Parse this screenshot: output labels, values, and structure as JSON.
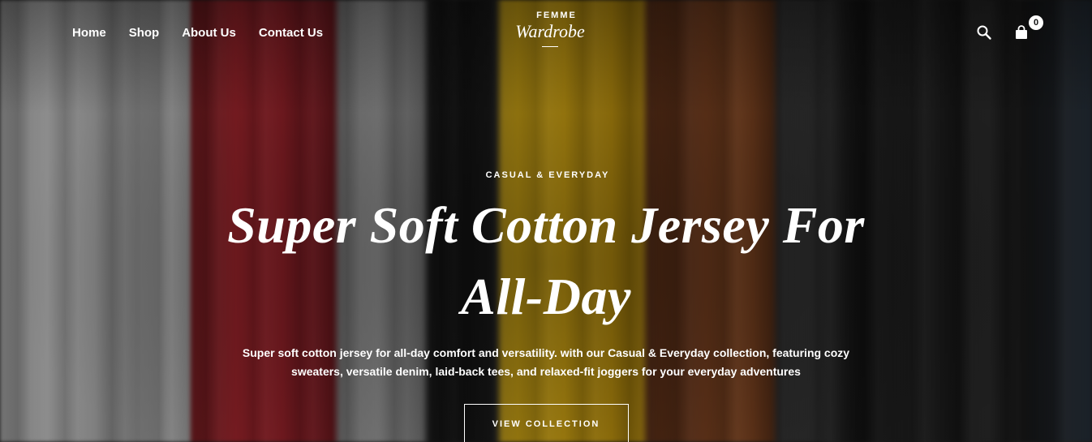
{
  "nav": {
    "items": [
      {
        "label": "Home"
      },
      {
        "label": "Shop"
      },
      {
        "label": "About Us"
      },
      {
        "label": "Contact Us"
      }
    ]
  },
  "logo": {
    "top": "FEMME",
    "main": "Wardrobe"
  },
  "header_icons": {
    "search_icon": "search-icon",
    "cart_icon": "shopping-bag-icon",
    "cart_count": "0"
  },
  "hero": {
    "eyebrow": "CASUAL & EVERYDAY",
    "headline": "Super Soft Cotton Jersey For All-Day",
    "subtext": "Super soft cotton jersey for all-day comfort and versatility. with our Casual & Everyday collection, featuring cozy sweaters, versatile denim, laid-back tees, and relaxed-fit joggers for your everyday adventures",
    "cta_label": "VIEW COLLECTION"
  },
  "colors": {
    "text": "#ffffff",
    "badge_bg": "#ffffff",
    "badge_text": "#111111"
  }
}
